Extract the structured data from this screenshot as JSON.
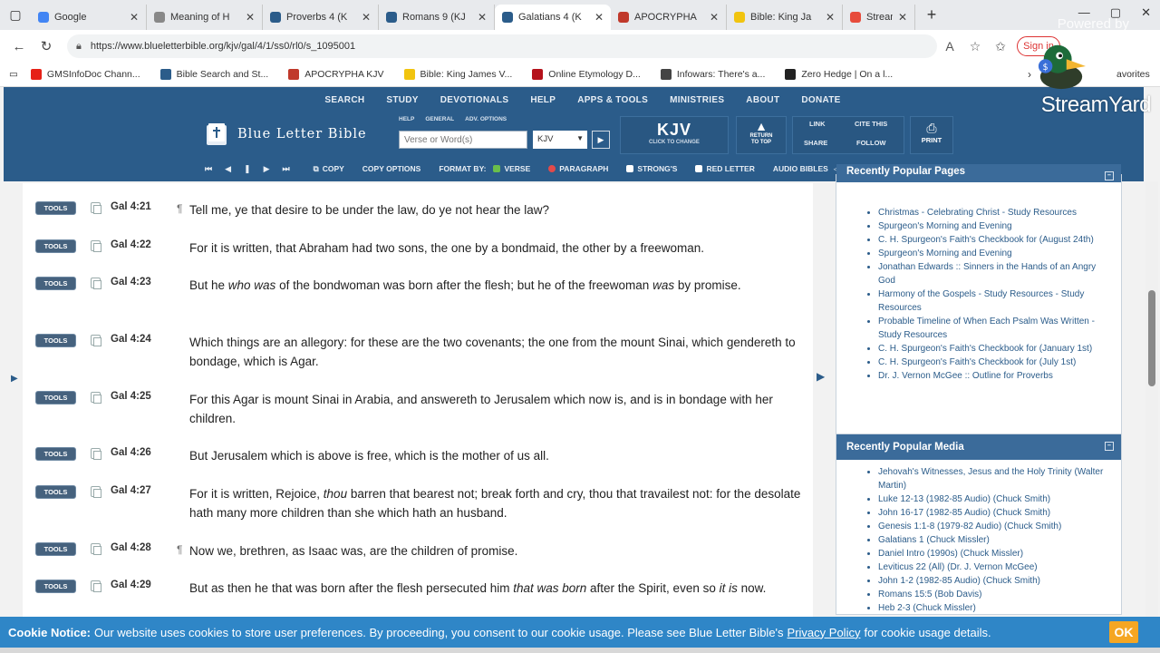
{
  "browser": {
    "tabs": [
      {
        "label": "Google",
        "color": "#4285f4"
      },
      {
        "label": "Meaning of H",
        "color": "#888888"
      },
      {
        "label": "Proverbs 4 (K",
        "color": "#2b5c8a"
      },
      {
        "label": "Romans 9 (KJ",
        "color": "#2b5c8a"
      },
      {
        "label": "Galatians 4 (K",
        "color": "#2b5c8a",
        "active": true
      },
      {
        "label": "APOCRYPHA",
        "color": "#c0392b"
      },
      {
        "label": "Bible: King Ja",
        "color": "#f1c40f"
      },
      {
        "label": "StreamYa",
        "color": "#e74c3c"
      }
    ],
    "url": "https://www.blueletterbible.org/kjv/gal/4/1/ss0/rl0/s_1095001",
    "signin_label": "Sign in",
    "bookmarks": [
      {
        "label": "GMSInfoDoc Chann...",
        "color": "#e62117"
      },
      {
        "label": "Bible Search and St...",
        "color": "#2b5c8a"
      },
      {
        "label": "APOCRYPHA KJV",
        "color": "#c0392b"
      },
      {
        "label": "Bible: King James V...",
        "color": "#f1c40f"
      },
      {
        "label": "Online Etymology D...",
        "color": "#b5121b"
      },
      {
        "label": "Infowars: There's a...",
        "color": "#444444"
      },
      {
        "label": "Zero Hedge | On a l...",
        "color": "#222222"
      }
    ],
    "favorites_label": "avorites"
  },
  "overlay": {
    "powered": "Powered by",
    "brand": "StreamYard"
  },
  "site": {
    "nav": [
      "SEARCH",
      "STUDY",
      "DEVOTIONALS",
      "HELP",
      "APPS & TOOLS",
      "MINISTRIES",
      "ABOUT",
      "DONATE"
    ],
    "logo_text": "Blue Letter Bible",
    "search_sub": [
      "HELP",
      "GENERAL",
      "ADV. OPTIONS"
    ],
    "search_placeholder": "Verse or Word(s)",
    "version": "KJV",
    "kjv_big": "KJV",
    "kjv_small": "CLICK TO CHANGE",
    "return_label1": "RETURN",
    "return_label2": "TO TOP",
    "link_label": "LINK",
    "cite_label": "CITE THIS",
    "share_label": "SHARE",
    "follow_label": "FOLLOW",
    "print_label": "PRINT",
    "toolbar": {
      "copy": "COPY",
      "copy_options": "COPY OPTIONS",
      "format_by": "FORMAT BY:",
      "verse": "VERSE",
      "paragraph": "PARAGRAPH",
      "strongs": "STRONG'S",
      "red_letter": "RED LETTER",
      "audio": "AUDIO BIBLES"
    }
  },
  "verses": [
    {
      "ref": "Gal 4:21",
      "pilcrow": true,
      "html": "Tell me, ye that desire to be under the law, do ye not hear the law?"
    },
    {
      "ref": "Gal 4:22",
      "pilcrow": false,
      "html": "For it is written, that Abraham had two sons, the one by a bondmaid, the other by a freewoman."
    },
    {
      "ref": "Gal 4:23",
      "pilcrow": false,
      "html": "But he <em>who was</em> of the bondwoman was born after the flesh; but he of the freewoman <em>was</em> by promise."
    },
    {
      "ref": "Gal 4:24",
      "pilcrow": false,
      "html": "Which things are an allegory: for these are the two covenants; the one from the mount Sinai, which gendereth to bondage, which is Agar."
    },
    {
      "ref": "Gal 4:25",
      "pilcrow": false,
      "html": "For this Agar is mount Sinai in Arabia, and answereth to Jerusalem which now is, and is in bondage with her children."
    },
    {
      "ref": "Gal 4:26",
      "pilcrow": false,
      "html": "But Jerusalem which is above is free, which is the mother of us all."
    },
    {
      "ref": "Gal 4:27",
      "pilcrow": false,
      "html": "For it is written, Rejoice, <em>thou</em> barren that bearest not; break forth and cry, thou that travailest not: for the desolate hath many more children than she which hath an husband."
    },
    {
      "ref": "Gal 4:28",
      "pilcrow": true,
      "html": "Now we, brethren, as Isaac was, are the children of promise."
    },
    {
      "ref": "Gal 4:29",
      "pilcrow": false,
      "html": "But as then he that was born after the flesh persecuted him <em>that was born</em> after the Spirit, even so <em>it is</em> now."
    }
  ],
  "tools_label": "TOOLS",
  "sidebar": {
    "pages_title": "Recently Popular Pages",
    "pages": [
      "Christmas - Celebrating Christ - Study Resources",
      "Spurgeon's Morning and Evening",
      "C. H. Spurgeon's Faith's Checkbook for (August 24th)",
      "Spurgeon's Morning and Evening",
      "Jonathan Edwards :: Sinners in the Hands of an Angry God",
      "Harmony of the Gospels - Study Resources - Study Resources",
      "Probable Timeline of When Each Psalm Was Written - Study Resources",
      "C. H. Spurgeon's Faith's Checkbook for (January 1st)",
      "C. H. Spurgeon's Faith's Checkbook for (July 1st)",
      "Dr. J. Vernon McGee :: Outline for Proverbs"
    ],
    "media_title": "Recently Popular Media",
    "media": [
      "Jehovah's Witnesses, Jesus and the Holy Trinity (Walter Martin)",
      "Luke 12-13 (1982-85 Audio) (Chuck Smith)",
      "John 16-17 (1982-85 Audio) (Chuck Smith)",
      "Genesis 1:1-8 (1979-82 Audio) (Chuck Smith)",
      "Galatians 1 (Chuck Missler)",
      "Daniel Intro (1990s) (Chuck Missler)",
      "Leviticus 22 (All) (Dr. J. Vernon McGee)",
      "John 1-2 (1982-85 Audio) (Chuck Smith)",
      "Romans 15:5 (Bob Davis)",
      "Heb 2-3 (Chuck Missler)"
    ]
  },
  "cookie": {
    "title": "Cookie Notice:",
    "text": "Our website uses cookies to store user preferences. By proceeding, you consent to our cookie usage. Please see Blue Letter Bible's",
    "link": "Privacy Policy",
    "tail": "for cookie usage details.",
    "ok": "OK"
  }
}
